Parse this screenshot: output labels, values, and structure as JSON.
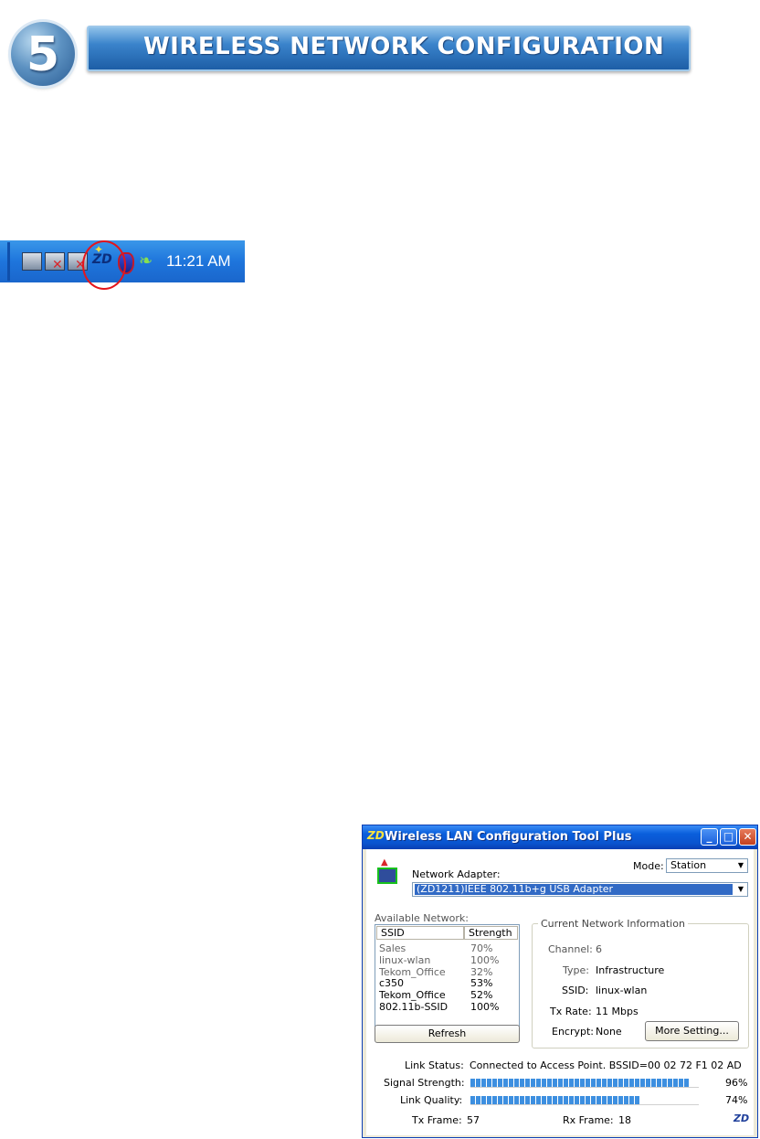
{
  "header": {
    "step_number": "5",
    "title": "WIRELESS NETWORK CONFIGURATION"
  },
  "taskbar": {
    "time": "11:21 AM",
    "icons": [
      "network-icon",
      "network-disconnected-icon",
      "network-disconnected-icon",
      "zd-wireless-icon",
      "shield-icon",
      "leaf-icon"
    ]
  },
  "window": {
    "title": "Wireless LAN Configuration Tool Plus",
    "title_icon": "ZD",
    "network_adapter_label": "Network Adapter:",
    "adapter_value": "(ZD1211)IEEE 802.11b+g USB Adapter",
    "mode_label": "Mode:",
    "mode_value": "Station",
    "available_network_label": "Available Network:",
    "list_headers": {
      "ssid": "SSID",
      "strength": "Strength"
    },
    "networks": [
      {
        "ssid": "Sales",
        "strength": "70%"
      },
      {
        "ssid": "linux-wlan",
        "strength": "100%"
      },
      {
        "ssid": "Tekom_Office",
        "strength": "32%"
      },
      {
        "ssid": "c350",
        "strength": "53%"
      },
      {
        "ssid": "Tekom_Office",
        "strength": "52%"
      },
      {
        "ssid": "802.11b-SSID",
        "strength": "100%"
      }
    ],
    "refresh_label": "Refresh",
    "current_info_title": "Current Network Information",
    "channel_label": "Channel:",
    "channel_value": "6",
    "type_label": "Type:",
    "type_value": "Infrastructure",
    "ssid_label": "SSID:",
    "ssid_value": "linux-wlan",
    "txrate_label": "Tx Rate:",
    "txrate_value": "11 Mbps",
    "encrypt_label": "Encrypt:",
    "encrypt_value": "None",
    "more_setting_label": "More Setting...",
    "link_status_label": "Link Status:",
    "link_status_value": "Connected to Access Point. BSSID=00 02 72 F1 02 AD",
    "signal_strength_label": "Signal Strength:",
    "signal_strength_value": "96%",
    "signal_strength_fraction": 0.96,
    "link_quality_label": "Link Quality:",
    "link_quality_value": "74%",
    "link_quality_fraction": 0.74,
    "tx_frame_label": "Tx Frame:",
    "tx_frame_value": "57",
    "rx_frame_label": "Rx Frame:",
    "rx_frame_value": "18",
    "corner_logo": "ZD"
  },
  "colors": {
    "title_bar": "#0a54cf",
    "progress": "#3d8fe0",
    "highlight": "#316ac5"
  }
}
